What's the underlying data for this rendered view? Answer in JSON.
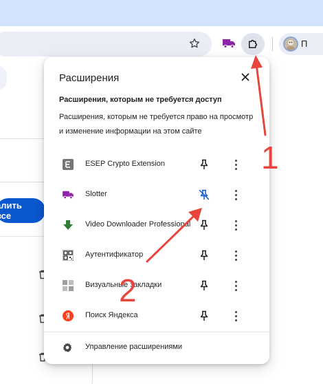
{
  "browser": {
    "profile_label": "П",
    "accent_color": "#0b57d0",
    "icons": [
      "star-icon",
      "truck-extension-icon",
      "puzzle-icon"
    ]
  },
  "background_page": {
    "delete_all_label": "алить все"
  },
  "extensions_popup": {
    "title": "Расширения",
    "section_title": "Расширения, которым не требуется доступ",
    "section_description": "Расширения, которым не требуется право на просмотр и изменение информации на этом сайте",
    "items": [
      {
        "name": "ESEP Crypto Extension",
        "icon": "letter-e-icon",
        "pinned": false
      },
      {
        "name": "Slotter",
        "icon": "truck-icon",
        "pinned": true
      },
      {
        "name": "Video Downloader Professional",
        "icon": "download-arrow-icon",
        "pinned": false
      },
      {
        "name": "Аутентификатор",
        "icon": "qr-code-icon",
        "pinned": false
      },
      {
        "name": "Визуальные закладки",
        "icon": "grid-icon",
        "pinned": false
      },
      {
        "name": "Поиск Яндекса",
        "icon": "yandex-icon",
        "pinned": false
      }
    ],
    "manage_label": "Управление расширениями"
  },
  "annotations": {
    "color": "#e8453c",
    "step_1": "1",
    "step_2": "2"
  }
}
